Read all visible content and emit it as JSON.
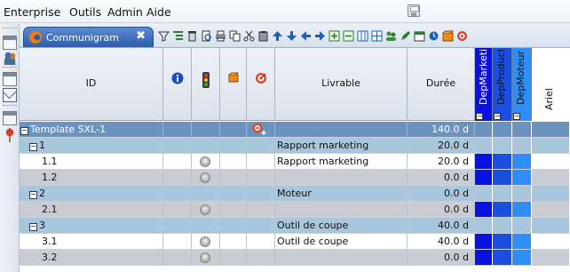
{
  "menubar": {
    "items": [
      "Enterprise",
      "Outils",
      "Admin",
      "Aide"
    ]
  },
  "tab": {
    "label": "Communigram",
    "close": "✖"
  },
  "columns": {
    "id": "ID",
    "livrable": "Livrable",
    "duree": "Durée",
    "departments": [
      "DepMarketing",
      "DepProduction",
      "DepMoteur",
      "Ariel"
    ]
  },
  "colors": {
    "dep_dark": "#0a10e0",
    "dep_mid": "#1b4fe0",
    "dep_light": "#2e8ef5",
    "project_row": "#6a93bf",
    "group_row": "#a9c7dc",
    "milestone_row": "#c9cdd3"
  },
  "rows": [
    {
      "kind": "project",
      "toggle": "−",
      "id": "Template SXL-1",
      "livrable": "",
      "duree": "140.0 d",
      "deps": []
    },
    {
      "kind": "group",
      "toggle": "−",
      "id": "1",
      "livrable": "Rapport marketing",
      "duree": "20.0 d",
      "deps": []
    },
    {
      "kind": "task",
      "id": "1.1",
      "livrable": "Rapport marketing",
      "duree": "20.0 d",
      "deps": [
        "dark",
        "mid",
        "light"
      ]
    },
    {
      "kind": "milestone",
      "id": "1.2",
      "livrable": "",
      "duree": "0.0 d",
      "deps": [
        "dark",
        "mid",
        "light"
      ]
    },
    {
      "kind": "group",
      "toggle": "−",
      "id": "2",
      "livrable": "Moteur",
      "duree": "0.0 d",
      "deps": []
    },
    {
      "kind": "milestone",
      "id": "2.1",
      "livrable": "",
      "duree": "0.0 d",
      "deps": [
        "dark",
        "mid",
        "light"
      ]
    },
    {
      "kind": "group",
      "toggle": "−",
      "id": "3",
      "livrable": "Outil de coupe",
      "duree": "40.0 d",
      "deps": []
    },
    {
      "kind": "task",
      "id": "3.1",
      "livrable": "Outil de coupe",
      "duree": "40.0 d",
      "deps": [
        "dark",
        "mid",
        "light"
      ]
    },
    {
      "kind": "milestone",
      "id": "3.2",
      "livrable": "",
      "duree": "0.0 d",
      "deps": [
        "dark",
        "mid",
        "light"
      ]
    }
  ]
}
